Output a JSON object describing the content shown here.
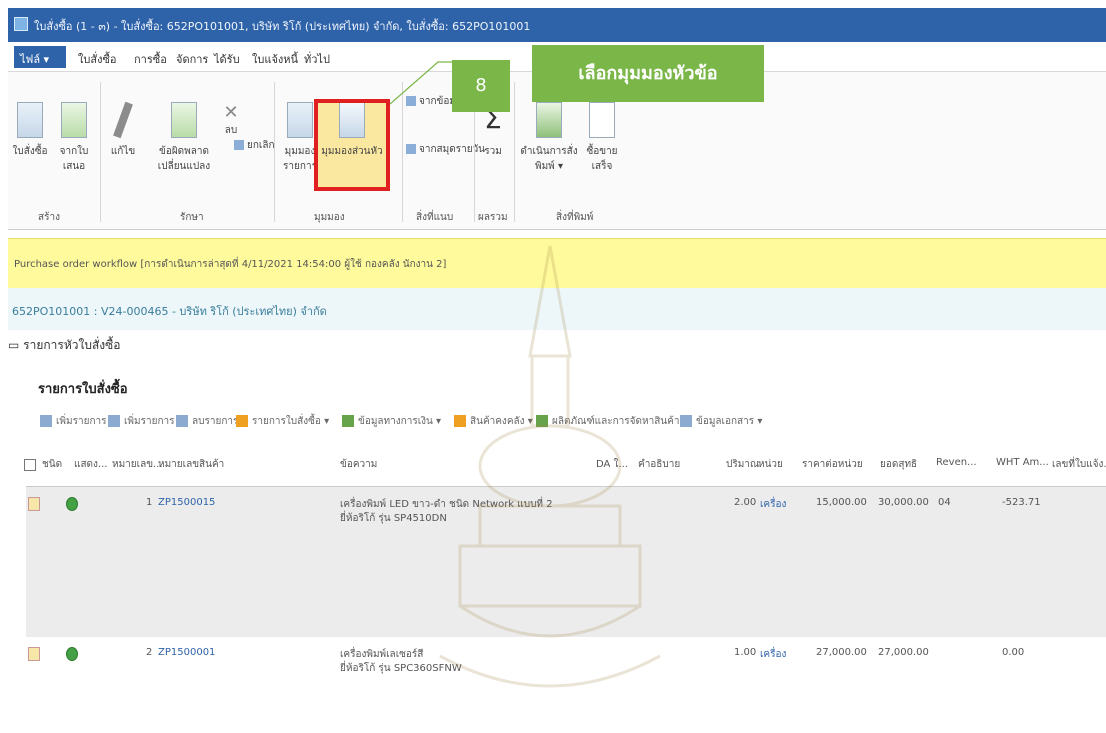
{
  "window": {
    "title": "ใบสั่งซื้อ (1 - ๓) - ใบสั่งซื้อ: 652PO101001, บริษัท ริโก้ (ประเทศไทย) จำกัด, ใบสั่งซื้อ: 652PO101001"
  },
  "menubar": {
    "file": "ไฟล์",
    "tabs": [
      "ใบสั่งซื้อ",
      "การซื้อ",
      "จัดการ",
      "ได้รับ",
      "ใบแจ้งหนี้",
      "ทั่วไป"
    ]
  },
  "ribbon": {
    "groups": {
      "new": {
        "label": "สร้าง",
        "buttons": [
          "ใบสั่งซื้อ",
          "จากใบเสนอ"
        ]
      },
      "maintain": {
        "label": "รักษา",
        "buttons": [
          "แก้ไข",
          "ข้อผิดพลาดเปลี่ยนแปลง",
          "ลบ"
        ],
        "small": [
          "ยกเลิก"
        ]
      },
      "view": {
        "label": "มุมมอง",
        "buttons": [
          "มุมมองรายการ",
          "มุมมองส่วนหัว"
        ]
      },
      "attachments": {
        "label": "สิ่งที่แนบ",
        "small": [
          "จากข้อมูล",
          "จากสมุดรายวัน"
        ]
      },
      "totals": {
        "label": "ผลรวม",
        "buttons": [
          "รวม"
        ]
      },
      "print": {
        "label": "สิ่งที่พิมพ์",
        "buttons": [
          "ดำเนินการสั่งพิมพ์",
          "ซื้อขายเสร็จ"
        ]
      }
    }
  },
  "callout": {
    "step": "8",
    "text": "เลือกมุมมองหัวข้อ"
  },
  "workflow": {
    "text": "Purchase order workflow [การดำเนินการล่าสุดที่ 4/11/2021 14:54:00 ผู้ใช้ กองคลัง นักงาน 2]"
  },
  "record": {
    "text": "652PO101001 : V24-000465 - บริษัท ริโก้ (ประเทศไทย) จำกัด"
  },
  "section": {
    "header": "รายการหัวใบสั่งซื้อ",
    "lines_title": "รายการใบสั่งซื้อ"
  },
  "line_toolbar": [
    "เพิ่มรายการ",
    "เพิ่มรายการ",
    "ลบรายการ",
    "รายการใบสั่งซื้อ",
    "ข้อมูลทางการเงิน",
    "สินค้าคงคลัง",
    "ผลิตภัณฑ์และการจัดหาสินค้า",
    "ข้อมูลเอกสาร"
  ],
  "grid": {
    "headers": [
      "ชนิด",
      "แสดง...",
      "หมายเลข...",
      "หมายเลขสินค้า",
      "ข้อความ",
      "DA ใ...",
      "คำอธิบาย",
      "ปริมาณ",
      "หน่วย",
      "ราคาต่อหน่วย",
      "ยอดสุทธิ",
      "Reven...",
      "WHT Am...",
      "เลขที่ใบแจ้ง..."
    ],
    "rows": [
      {
        "line": "1",
        "item": "ZP1500015",
        "text1": "เครื่องพิมพ์ LED ขาว-ดำ ชนิด Network แบบที่ 2",
        "text2": "ยี่ห้อริโก้ รุ่น SP4510DN",
        "qty": "2.00",
        "unit": "เครื่อง",
        "price": "15,000.00",
        "net": "30,000.00",
        "rev": "04",
        "wht": "-523.71"
      },
      {
        "line": "2",
        "item": "ZP1500001",
        "text1": "เครื่องพิมพ์เลเซอร์สี",
        "text2": "ยี่ห้อริโก้ รุ่น SPC360SFNW",
        "qty": "1.00",
        "unit": "เครื่อง",
        "price": "27,000.00",
        "net": "27,000.00",
        "rev": "",
        "wht": "0.00"
      }
    ]
  }
}
